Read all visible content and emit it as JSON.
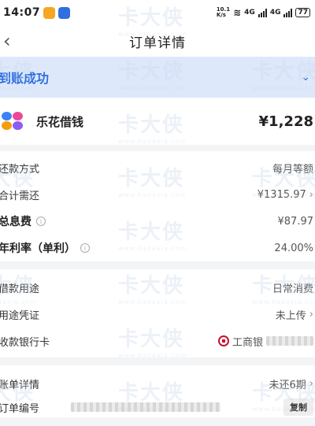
{
  "status_bar": {
    "time": "14:07",
    "net_speed": "10.1\nK/s",
    "signal_1": "4G",
    "signal_2": "4G",
    "battery": "77"
  },
  "nav": {
    "title": "订单详情"
  },
  "order_status": {
    "text": "到账成功"
  },
  "product": {
    "name": "乐花借钱",
    "amount": "¥1,228"
  },
  "repayment": {
    "method_label": "还款方式",
    "method_value": "每月等额",
    "total_label": "合计需还",
    "total_value": "¥1315.97",
    "interest_label": "总息费",
    "interest_value": "¥87.97",
    "rate_label": "年利率（单利）",
    "rate_value": "24.00%"
  },
  "loan": {
    "purpose_label": "借款用途",
    "purpose_value": "日常消费",
    "proof_label": "用途凭证",
    "proof_value": "未上传",
    "bank_label": "收款银行卡",
    "bank_value": "工商银"
  },
  "bill": {
    "detail_label": "账单详情",
    "detail_value": "未还6期",
    "order_no_label": "订单编号",
    "copy_label": "复制"
  },
  "watermark": {
    "text": "卡大侠",
    "url": "www.kadaxia.com"
  },
  "colors": {
    "accent": "#2f6fe0",
    "banner_bg": "#dde8fb",
    "bank_red": "#c8102e"
  }
}
